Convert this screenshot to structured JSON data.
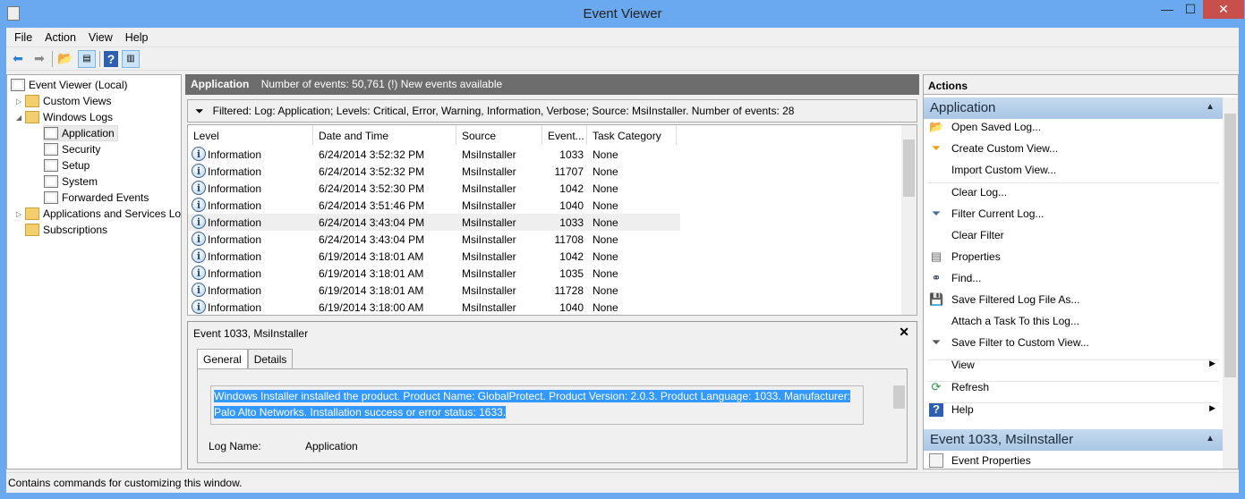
{
  "window": {
    "title": "Event Viewer",
    "minimize": "—",
    "maximize": "☐",
    "close": "✕"
  },
  "menu": [
    "File",
    "Action",
    "View",
    "Help"
  ],
  "tree": {
    "root": "Event Viewer (Local)",
    "custom_views": "Custom Views",
    "windows_logs": "Windows Logs",
    "logs": [
      "Application",
      "Security",
      "Setup",
      "System",
      "Forwarded Events"
    ],
    "app_services": "Applications and Services Lo",
    "subscriptions": "Subscriptions"
  },
  "center": {
    "log_name": "Application",
    "event_count": "Number of events: 50,761 (!) New events available",
    "filter": "Filtered: Log: Application; Levels: Critical, Error, Warning, Information, Verbose; Source: MsiInstaller. Number of events: 28",
    "columns": [
      "Level",
      "Date and Time",
      "Source",
      "Event...",
      "Task Category"
    ],
    "rows": [
      [
        "Information",
        "6/24/2014 3:52:32 PM",
        "MsiInstaller",
        "1033",
        "None"
      ],
      [
        "Information",
        "6/24/2014 3:52:32 PM",
        "MsiInstaller",
        "11707",
        "None"
      ],
      [
        "Information",
        "6/24/2014 3:52:30 PM",
        "MsiInstaller",
        "1042",
        "None"
      ],
      [
        "Information",
        "6/24/2014 3:51:46 PM",
        "MsiInstaller",
        "1040",
        "None"
      ],
      [
        "Information",
        "6/24/2014 3:43:04 PM",
        "MsiInstaller",
        "1033",
        "None"
      ],
      [
        "Information",
        "6/24/2014 3:43:04 PM",
        "MsiInstaller",
        "11708",
        "None"
      ],
      [
        "Information",
        "6/19/2014 3:18:01 AM",
        "MsiInstaller",
        "1042",
        "None"
      ],
      [
        "Information",
        "6/19/2014 3:18:01 AM",
        "MsiInstaller",
        "1035",
        "None"
      ],
      [
        "Information",
        "6/19/2014 3:18:01 AM",
        "MsiInstaller",
        "11728",
        "None"
      ],
      [
        "Information",
        "6/19/2014 3:18:00 AM",
        "MsiInstaller",
        "1040",
        "None"
      ]
    ]
  },
  "detail": {
    "title": "Event 1033, MsiInstaller",
    "tabs": [
      "General",
      "Details"
    ],
    "message_line1": "Windows Installer installed the product. Product Name: GlobalProtect. Product Version: 2.0.3. Product Language: 1033. Manufacturer:",
    "message_line2": "Palo Alto Networks. Installation success or error status: 1633.",
    "log_name_label": "Log Name:",
    "log_name_value": "Application"
  },
  "actions": {
    "header": "Actions",
    "section1": "Application",
    "items": [
      "Open Saved Log...",
      "Create Custom View...",
      "Import Custom View...",
      "Clear Log...",
      "Filter Current Log...",
      "Clear Filter",
      "Properties",
      "Find...",
      "Save Filtered Log File As...",
      "Attach a Task To this Log...",
      "Save Filter to Custom View...",
      "View",
      "Refresh",
      "Help"
    ],
    "section2": "Event 1033, MsiInstaller",
    "event_properties": "Event Properties"
  },
  "status": "Contains commands for customizing this window."
}
